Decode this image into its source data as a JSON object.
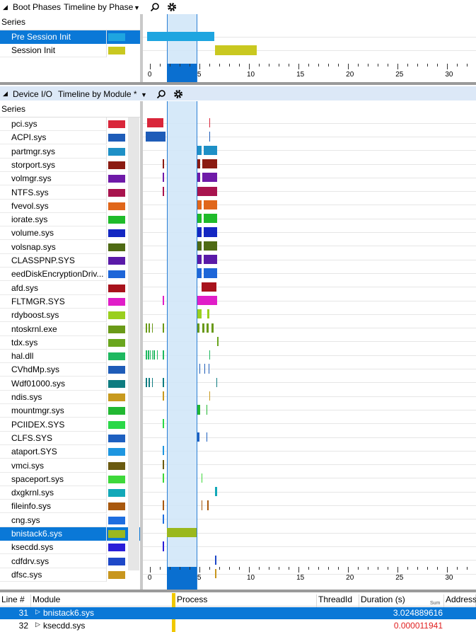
{
  "top_panel": {
    "title": "Boot Phases",
    "view": "Timeline by Phase",
    "series_header": "Series",
    "series": [
      {
        "label": "Pre Session Init",
        "color": "#1ea5e0",
        "selected": true
      },
      {
        "label": "Session Init",
        "color": "#c9c820",
        "selected": false
      }
    ],
    "bars": [
      {
        "series": 0,
        "start": -0.3,
        "end": 6.5
      },
      {
        "series": 1,
        "start": 6.6,
        "end": 10.8
      }
    ]
  },
  "axis": {
    "min": -0.7,
    "max": 32.9,
    "tick_labels": [
      "0",
      "5",
      "10",
      "15",
      "20",
      "25",
      "30"
    ]
  },
  "selection": {
    "start": 1.7,
    "end": 4.7
  },
  "bottom_panel": {
    "title": "Device I/O",
    "view": "Timeline by Module *",
    "series_header": "Series",
    "series": [
      {
        "label": "pci.sys",
        "color": "#d9263a"
      },
      {
        "label": "ACPI.sys",
        "color": "#1e5cb8"
      },
      {
        "label": "partmgr.sys",
        "color": "#1e90c6"
      },
      {
        "label": "storport.sys",
        "color": "#8b1b12"
      },
      {
        "label": "volmgr.sys",
        "color": "#6f1aa8"
      },
      {
        "label": "NTFS.sys",
        "color": "#a8144e"
      },
      {
        "label": "fvevol.sys",
        "color": "#e0661a"
      },
      {
        "label": "iorate.sys",
        "color": "#1fbb2a"
      },
      {
        "label": "volume.sys",
        "color": "#1427c2"
      },
      {
        "label": "volsnap.sys",
        "color": "#4e6a14"
      },
      {
        "label": "CLASSPNP.SYS",
        "color": "#5a1aa8"
      },
      {
        "label": "eedDiskEncryptionDriv...",
        "color": "#1e66d8"
      },
      {
        "label": "afd.sys",
        "color": "#a8121c"
      },
      {
        "label": "FLTMGR.SYS",
        "color": "#e01ec8"
      },
      {
        "label": "rdyboost.sys",
        "color": "#9acf1e"
      },
      {
        "label": "ntoskrnl.exe",
        "color": "#6a9a18"
      },
      {
        "label": "tdx.sys",
        "color": "#6aa61e"
      },
      {
        "label": "hal.dll",
        "color": "#1eb860"
      },
      {
        "label": "CVhdMp.sys",
        "color": "#1e5cb8"
      },
      {
        "label": "Wdf01000.sys",
        "color": "#0e7c80"
      },
      {
        "label": "ndis.sys",
        "color": "#c89a1e"
      },
      {
        "label": "mountmgr.sys",
        "color": "#22b832"
      },
      {
        "label": "PCIIDEX.SYS",
        "color": "#2ad848"
      },
      {
        "label": "CLFS.SYS",
        "color": "#1e60c0"
      },
      {
        "label": "ataport.SYS",
        "color": "#1e96e0"
      },
      {
        "label": "vmci.sys",
        "color": "#6a5a10"
      },
      {
        "label": "spaceport.sys",
        "color": "#3ed83a"
      },
      {
        "label": "dxgkrnl.sys",
        "color": "#12a8b8"
      },
      {
        "label": "fileinfo.sys",
        "color": "#a8580e"
      },
      {
        "label": "cng.sys",
        "color": "#1e6ee0"
      },
      {
        "label": "bnistack6.sys",
        "color": "#9ab81e",
        "selected": true
      },
      {
        "label": "ksecdd.sys",
        "color": "#2a1ed8"
      },
      {
        "label": "cdfdrv.sys",
        "color": "#1e48c8"
      },
      {
        "label": "dfsc.sys",
        "color": "#c8961e"
      }
    ],
    "bars": [
      [
        [
          -0.3,
          1.4
        ],
        [
          6.0,
          6.1
        ]
      ],
      [
        [
          -0.4,
          1.6
        ],
        [
          6.0,
          6.1
        ]
      ],
      [
        [
          4.8,
          5.2
        ],
        [
          5.4,
          6.8
        ]
      ],
      [
        [
          1.3,
          1.4
        ],
        [
          4.8,
          5.1
        ],
        [
          5.3,
          6.8
        ]
      ],
      [
        [
          1.3,
          1.4
        ],
        [
          4.8,
          5.1
        ],
        [
          5.3,
          6.8
        ]
      ],
      [
        [
          1.3,
          1.4
        ],
        [
          4.8,
          6.8
        ]
      ],
      [
        [
          4.8,
          5.2
        ],
        [
          5.4,
          6.8
        ]
      ],
      [
        [
          4.8,
          5.2
        ],
        [
          5.4,
          6.8
        ]
      ],
      [
        [
          4.8,
          5.2
        ],
        [
          5.4,
          6.8
        ]
      ],
      [
        [
          4.8,
          5.2
        ],
        [
          5.4,
          6.8
        ]
      ],
      [
        [
          4.8,
          5.2
        ],
        [
          5.4,
          6.8
        ]
      ],
      [
        [
          4.8,
          5.2
        ],
        [
          5.4,
          6.8
        ]
      ],
      [
        [
          5.2,
          6.7
        ]
      ],
      [
        [
          1.3,
          1.4
        ],
        [
          4.8,
          6.8
        ]
      ],
      [
        [
          4.8,
          5.2
        ],
        [
          5.8,
          6.0
        ]
      ],
      [
        [
          -0.4,
          -0.3
        ],
        [
          -0.1,
          0.0
        ],
        [
          0.2,
          0.3
        ],
        [
          1.3,
          1.4
        ],
        [
          4.8,
          5.0
        ],
        [
          5.3,
          5.5
        ],
        [
          5.7,
          5.9
        ],
        [
          6.2,
          6.4
        ]
      ],
      [
        [
          6.8,
          6.9
        ]
      ],
      [
        [
          -0.4,
          -0.3
        ],
        [
          -0.2,
          -0.1
        ],
        [
          0.0,
          0.1
        ],
        [
          0.2,
          0.3
        ],
        [
          0.4,
          0.5
        ],
        [
          0.7,
          0.8
        ],
        [
          1.3,
          1.4
        ],
        [
          6.0,
          6.1
        ]
      ],
      [
        [
          5.0,
          5.1
        ],
        [
          5.5,
          5.6
        ],
        [
          5.9,
          6.0
        ]
      ],
      [
        [
          -0.4,
          -0.3
        ],
        [
          -0.1,
          0.0
        ],
        [
          0.2,
          0.3
        ],
        [
          1.3,
          1.4
        ],
        [
          6.7,
          6.8
        ]
      ],
      [
        [
          1.3,
          1.4
        ],
        [
          6.0,
          6.1
        ]
      ],
      [
        [
          4.8,
          5.1
        ],
        [
          5.7,
          5.8
        ]
      ],
      [
        [
          1.3,
          1.4
        ]
      ],
      [
        [
          4.8,
          5.0
        ],
        [
          5.7,
          5.8
        ]
      ],
      [
        [
          1.3,
          1.4
        ]
      ],
      [
        [
          1.3,
          1.4
        ]
      ],
      [
        [
          1.3,
          1.4
        ],
        [
          5.2,
          5.3
        ]
      ],
      [
        [
          6.6,
          6.8
        ]
      ],
      [
        [
          1.3,
          1.4
        ],
        [
          5.2,
          5.3
        ],
        [
          5.8,
          5.9
        ]
      ],
      [
        [
          1.3,
          1.4
        ]
      ],
      [
        [
          1.7,
          4.7
        ]
      ],
      [
        [
          1.3,
          1.4
        ]
      ],
      [
        [
          6.6,
          6.7
        ]
      ],
      [
        [
          6.6,
          6.7
        ]
      ]
    ]
  },
  "table": {
    "columns": [
      "Line #",
      "Module",
      "Process",
      "ThreadId",
      "Duration (s)",
      "Address"
    ],
    "duration_sub": "Sum",
    "rows": [
      {
        "line": "31",
        "module": "bnistack6.sys",
        "process": "",
        "thread": "",
        "duration": "3.024889616",
        "selected": true
      },
      {
        "line": "32",
        "module": "ksecdd.sys",
        "process": "",
        "thread": "",
        "duration": "0.000011941",
        "selected": false
      }
    ]
  }
}
